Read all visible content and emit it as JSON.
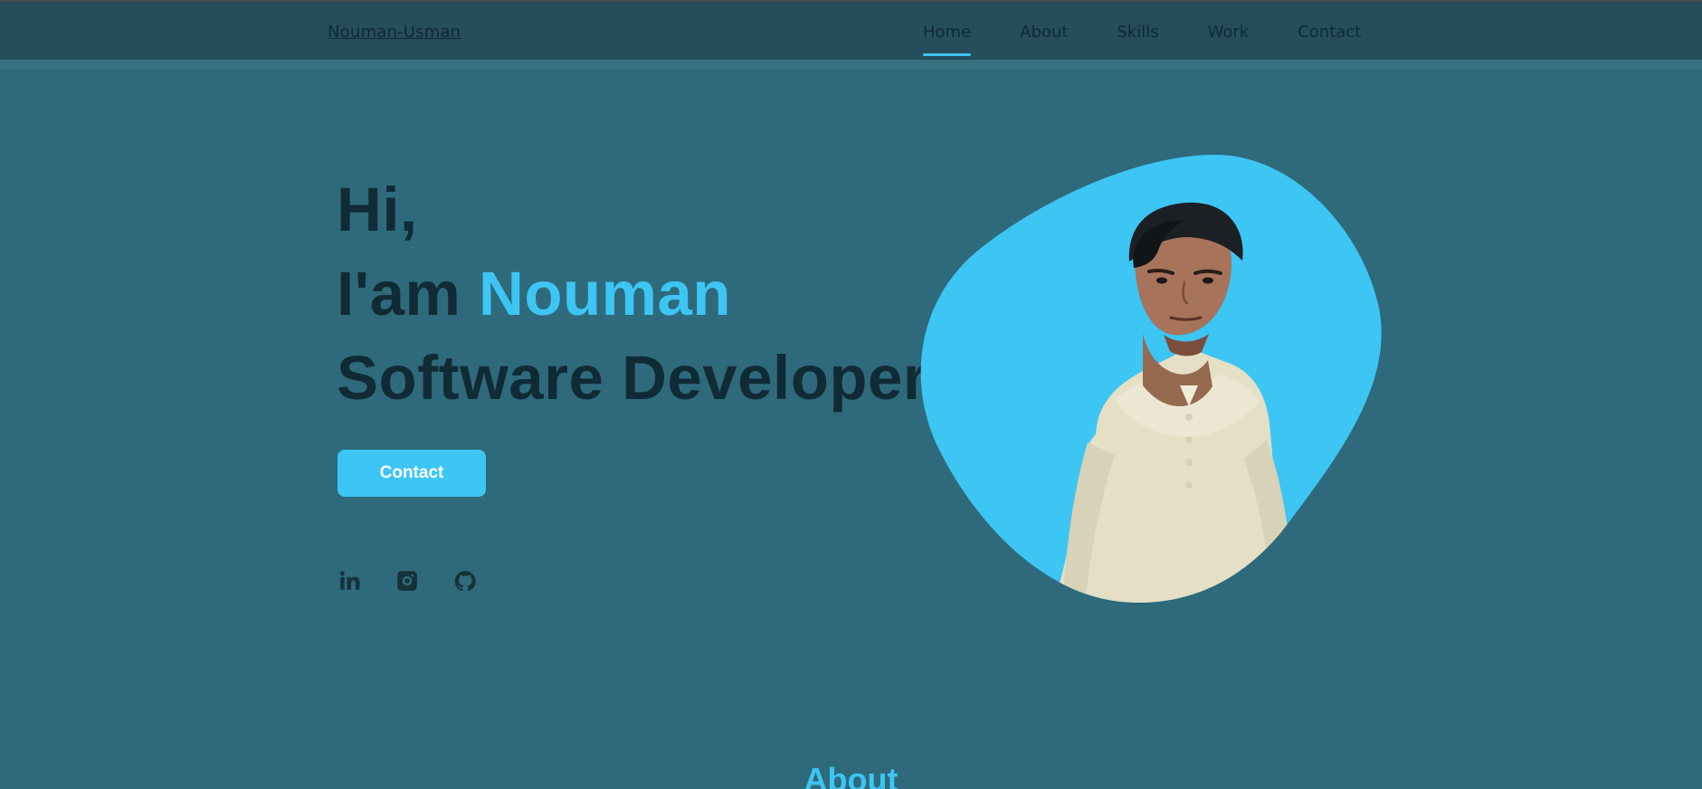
{
  "header": {
    "logo": "Nouman-Usman",
    "nav": {
      "home": "Home",
      "about": "About",
      "skills": "Skills",
      "work": "Work",
      "contact": "Contact"
    }
  },
  "hero": {
    "greeting": "Hi,",
    "intro_prefix": "I'am ",
    "name": "Nouman",
    "role": "Software Developer",
    "contact_button": "Contact",
    "social_icons": [
      "linkedin-icon",
      "instagram-icon",
      "github-icon"
    ]
  },
  "about": {
    "heading": "About"
  },
  "colors": {
    "background": "#2e6a7b",
    "header": "#254d5c",
    "accent": "#3dc5f4",
    "text_dark": "#112b36",
    "button_text": "#ffffff"
  }
}
